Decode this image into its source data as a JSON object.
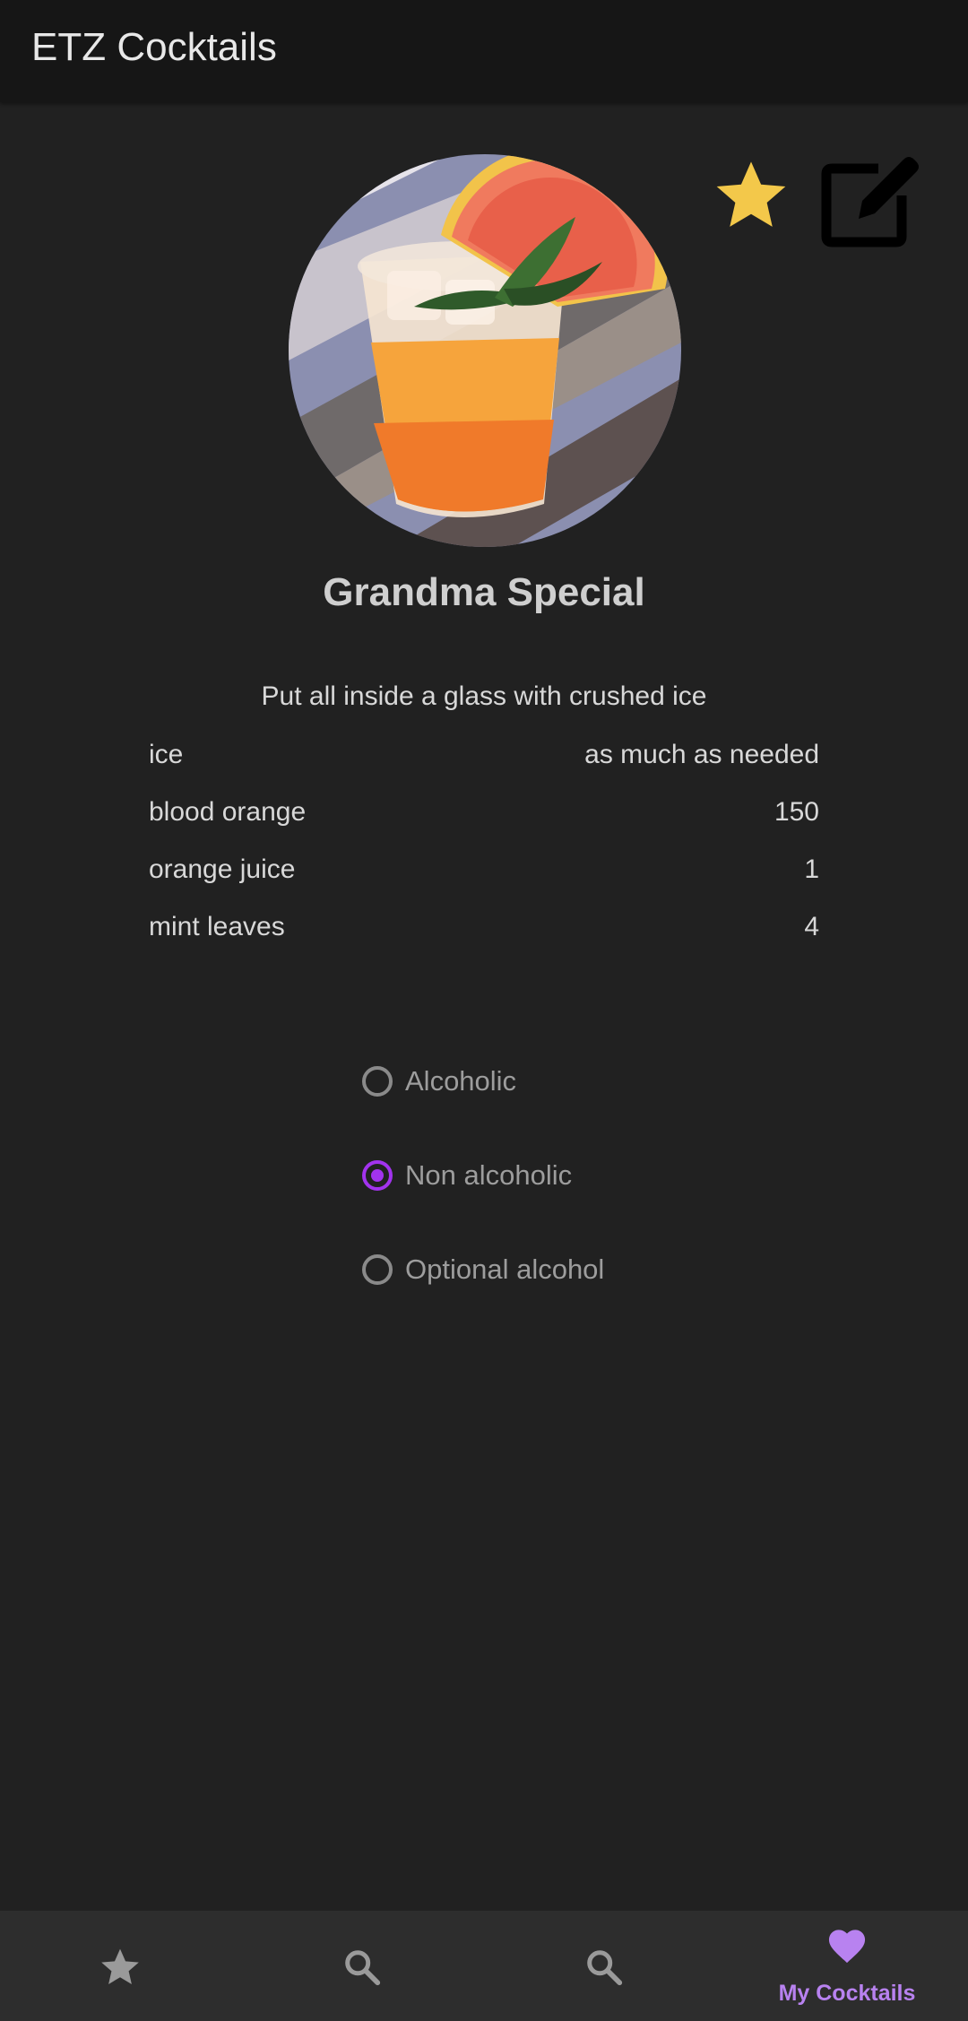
{
  "app": {
    "title": "ETZ Cocktails"
  },
  "icons": {
    "favorite": "star-icon",
    "edit": "edit-note-icon",
    "nav_favorites": "star-icon",
    "nav_search_1": "search-icon",
    "nav_search_2": "search-icon",
    "nav_my_cocktails": "heart-icon"
  },
  "colors": {
    "background": "#212121",
    "app_bar": "#161616",
    "favorite_star": "#f3c84a",
    "accent": "#a233ee",
    "nav_active": "#b882f0",
    "bottom_nav": "#2d2d2d"
  },
  "cocktail": {
    "name": "Grandma Special",
    "instructions": "Put all inside a glass with crushed ice",
    "ingredients": [
      {
        "name": "ice",
        "amount": "as much as needed"
      },
      {
        "name": "blood orange",
        "amount": "150"
      },
      {
        "name": "orange juice",
        "amount": "1"
      },
      {
        "name": "mint leaves",
        "amount": "4"
      }
    ]
  },
  "alcohol_options": [
    {
      "label": "Alcoholic",
      "selected": false
    },
    {
      "label": "Non alcoholic",
      "selected": true
    },
    {
      "label": "Optional alcohol",
      "selected": false
    }
  ],
  "bottom_nav": {
    "items": [
      {
        "icon": "star-icon",
        "label": "",
        "active": false
      },
      {
        "icon": "search-icon",
        "label": "",
        "active": false
      },
      {
        "icon": "search-icon",
        "label": "",
        "active": false
      },
      {
        "icon": "heart-icon",
        "label": "My Cocktails",
        "active": true
      }
    ]
  }
}
